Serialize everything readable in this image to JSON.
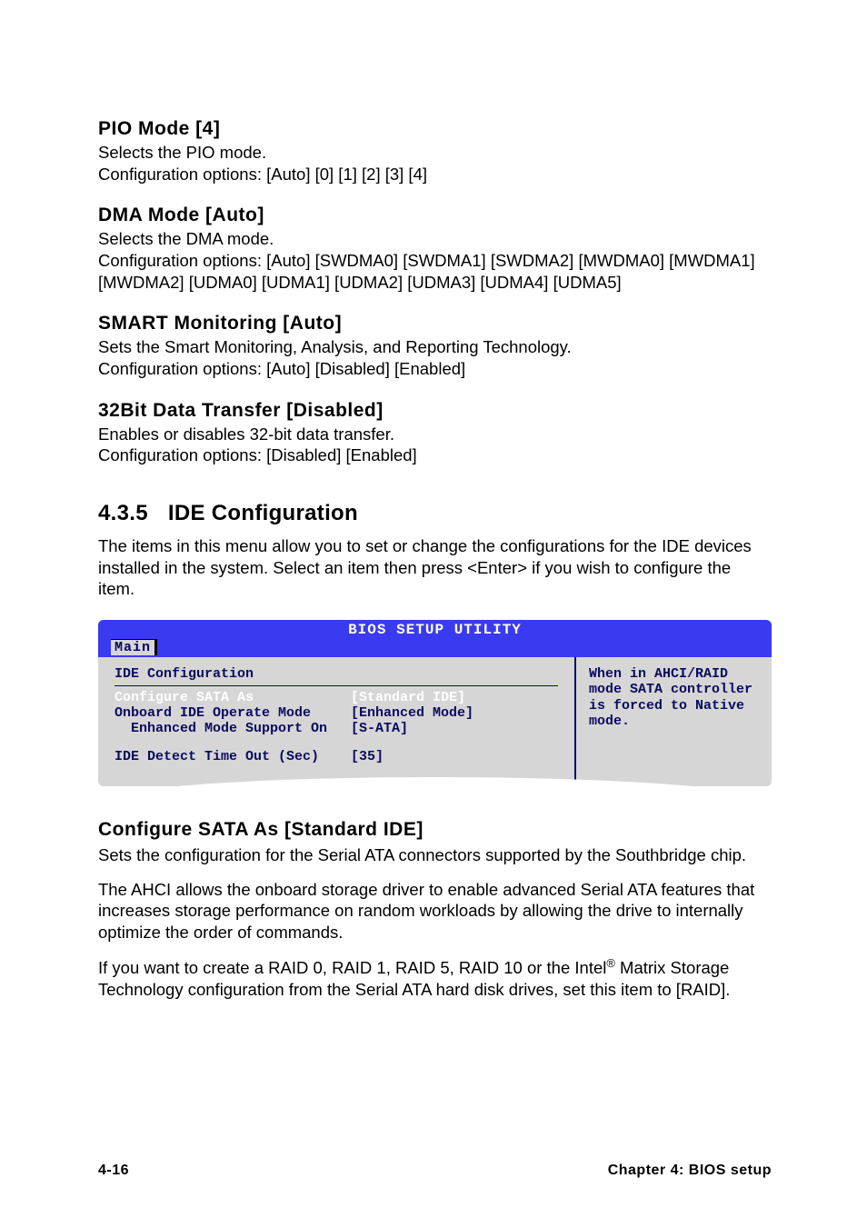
{
  "sections": {
    "pio": {
      "heading": "PIO Mode [4]",
      "desc": "Selects the PIO mode.",
      "opts": "Configuration options: [Auto] [0] [1] [2] [3] [4]"
    },
    "dma": {
      "heading": "DMA Mode [Auto]",
      "desc": "Selects the DMA mode.",
      "opts": "Configuration options: [Auto] [SWDMA0] [SWDMA1] [SWDMA2] [MWDMA0] [MWDMA1] [MWDMA2] [UDMA0] [UDMA1] [UDMA2] [UDMA3] [UDMA4] [UDMA5]"
    },
    "smart": {
      "heading": "SMART Monitoring [Auto]",
      "desc": "Sets the Smart Monitoring, Analysis, and Reporting Technology.",
      "opts": "Configuration options: [Auto] [Disabled] [Enabled]"
    },
    "bit32": {
      "heading": "32Bit Data Transfer [Disabled]",
      "desc": "Enables or disables 32-bit data transfer.",
      "opts": "Configuration options: [Disabled] [Enabled]"
    }
  },
  "major": {
    "num": "4.3.5",
    "title": "IDE Configuration",
    "intro": "The items in this menu allow you to set or change the configurations for the IDE devices installed in the system. Select an item then press <Enter> if you wish to configure the item."
  },
  "bios": {
    "header": "BIOS SETUP UTILITY",
    "tab": "Main",
    "subtitle": "IDE Configuration",
    "rows": [
      {
        "label": "Configure SATA As",
        "value": "[Standard IDE]",
        "selected": true
      },
      {
        "label": "Onboard IDE Operate Mode",
        "value": "[Enhanced Mode]",
        "selected": false
      },
      {
        "label": "  Enhanced Mode Support On",
        "value": "[S-ATA]",
        "selected": false
      }
    ],
    "row_gap": {
      "label": "IDE Detect Time Out (Sec)",
      "value": "[35]"
    },
    "help": "When in AHCI/RAID mode SATA controller is forced to Native mode."
  },
  "configure_sata": {
    "heading": "Configure SATA As [Standard IDE]",
    "p1": "Sets the configuration for the Serial ATA connectors supported by the Southbridge chip.",
    "p2": "The AHCI allows the onboard storage driver to enable advanced Serial ATA features that increases storage performance on random workloads by allowing the drive to internally optimize the order of commands.",
    "p3a": "If you want to create a RAID 0, RAID 1, RAID 5, RAID 10 or the Intel",
    "p3sup": "®",
    "p3b": " Matrix Storage Technology configuration from the Serial ATA hard disk drives, set this item to [RAID]."
  },
  "footer": {
    "page": "4-16",
    "chapter": "Chapter 4: BIOS setup"
  }
}
